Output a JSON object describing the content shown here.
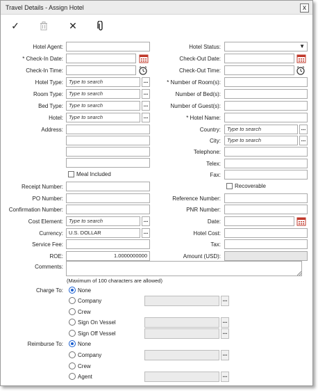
{
  "window": {
    "title": "Travel Details - Assign Hotel",
    "close_glyph": "x"
  },
  "toolbar": {
    "save_glyph": "✓",
    "delete_glyph": "🗑",
    "cancel_glyph": "✕",
    "attach_glyph": "📎"
  },
  "dots_label": "...",
  "left": {
    "hotel_agent": {
      "label": "Hotel Agent:",
      "value": ""
    },
    "check_in_date": {
      "label": "* Check-In Date:",
      "value": ""
    },
    "check_in_time": {
      "label": "Check-In Time:",
      "value": ""
    },
    "hotel_type": {
      "label": "Hotel Type:",
      "placeholder": "Type to search"
    },
    "room_type": {
      "label": "Room Type:",
      "placeholder": "Type to search"
    },
    "bed_type": {
      "label": "Bed Type:",
      "placeholder": "Type to search"
    },
    "hotel": {
      "label": "Hotel:",
      "placeholder": "Type to search"
    },
    "address": {
      "label": "Address:",
      "lines": [
        "",
        "",
        "",
        ""
      ]
    },
    "meal_included": {
      "label": "Meal Included",
      "checked": false
    },
    "receipt_number": {
      "label": "Receipt Number:",
      "value": ""
    },
    "po_number": {
      "label": "PO Number:",
      "value": ""
    },
    "confirmation_number": {
      "label": "Confirmation Number:",
      "value": ""
    },
    "cost_element": {
      "label": "Cost Element:",
      "placeholder": "Type to search"
    },
    "currency": {
      "label": "Currency:",
      "value": "U.S.  DOLLAR"
    },
    "service_fee": {
      "label": "Service Fee:",
      "value": ""
    },
    "roe": {
      "label": "ROE:",
      "value": "1.0000000000"
    },
    "comments": {
      "label": "Comments:",
      "value": "",
      "hint": "(Maximum of 100 characters are allowed)"
    }
  },
  "right": {
    "hotel_status": {
      "label": "Hotel Status:",
      "value": ""
    },
    "check_out_date": {
      "label": "Check-Out Date:",
      "value": ""
    },
    "check_out_time": {
      "label": "Check-Out Time:",
      "value": ""
    },
    "number_of_rooms": {
      "label": "* Number of Room(s):",
      "value": ""
    },
    "number_of_beds": {
      "label": "Number of Bed(s):",
      "value": ""
    },
    "number_of_guests": {
      "label": "Number of Guest(s):",
      "value": ""
    },
    "hotel_name": {
      "label": "* Hotel Name:",
      "value": ""
    },
    "country": {
      "label": "Country:",
      "placeholder": "Type to search"
    },
    "city": {
      "label": "City:",
      "placeholder": "Type to search"
    },
    "telephone": {
      "label": "Telephone:",
      "value": ""
    },
    "telex": {
      "label": "Telex:",
      "value": ""
    },
    "fax": {
      "label": "Fax:",
      "value": ""
    },
    "recoverable": {
      "label": "Recoverable",
      "checked": false
    },
    "reference_number": {
      "label": "Reference Number:",
      "value": ""
    },
    "pnr_number": {
      "label": "PNR Number:",
      "value": ""
    },
    "date": {
      "label": "Date:",
      "value": ""
    },
    "hotel_cost": {
      "label": "Hotel Cost:",
      "value": ""
    },
    "tax": {
      "label": "Tax:",
      "value": ""
    },
    "amount_usd": {
      "label": "Amount (USD):",
      "value": ""
    }
  },
  "charge_to": {
    "label": "Charge To:",
    "selected": "None",
    "options": [
      {
        "label": "None",
        "has_lookup": false
      },
      {
        "label": "Company",
        "has_lookup": true,
        "value": ""
      },
      {
        "label": "Crew",
        "has_lookup": false
      },
      {
        "label": "Sign On Vessel",
        "has_lookup": true,
        "value": ""
      },
      {
        "label": "Sign Off Vessel",
        "has_lookup": true,
        "value": ""
      }
    ]
  },
  "reimburse_to": {
    "label": "Reimburse To:",
    "selected": "None",
    "options": [
      {
        "label": "None",
        "has_lookup": false
      },
      {
        "label": "Company",
        "has_lookup": true,
        "value": ""
      },
      {
        "label": "Crew",
        "has_lookup": false
      },
      {
        "label": "Agent",
        "has_lookup": true,
        "value": ""
      }
    ]
  },
  "colors": {
    "calendar_icon": "#c0392b",
    "radio_selected": "#1a5fd1",
    "readonly_bg": "#e7e7e7"
  }
}
